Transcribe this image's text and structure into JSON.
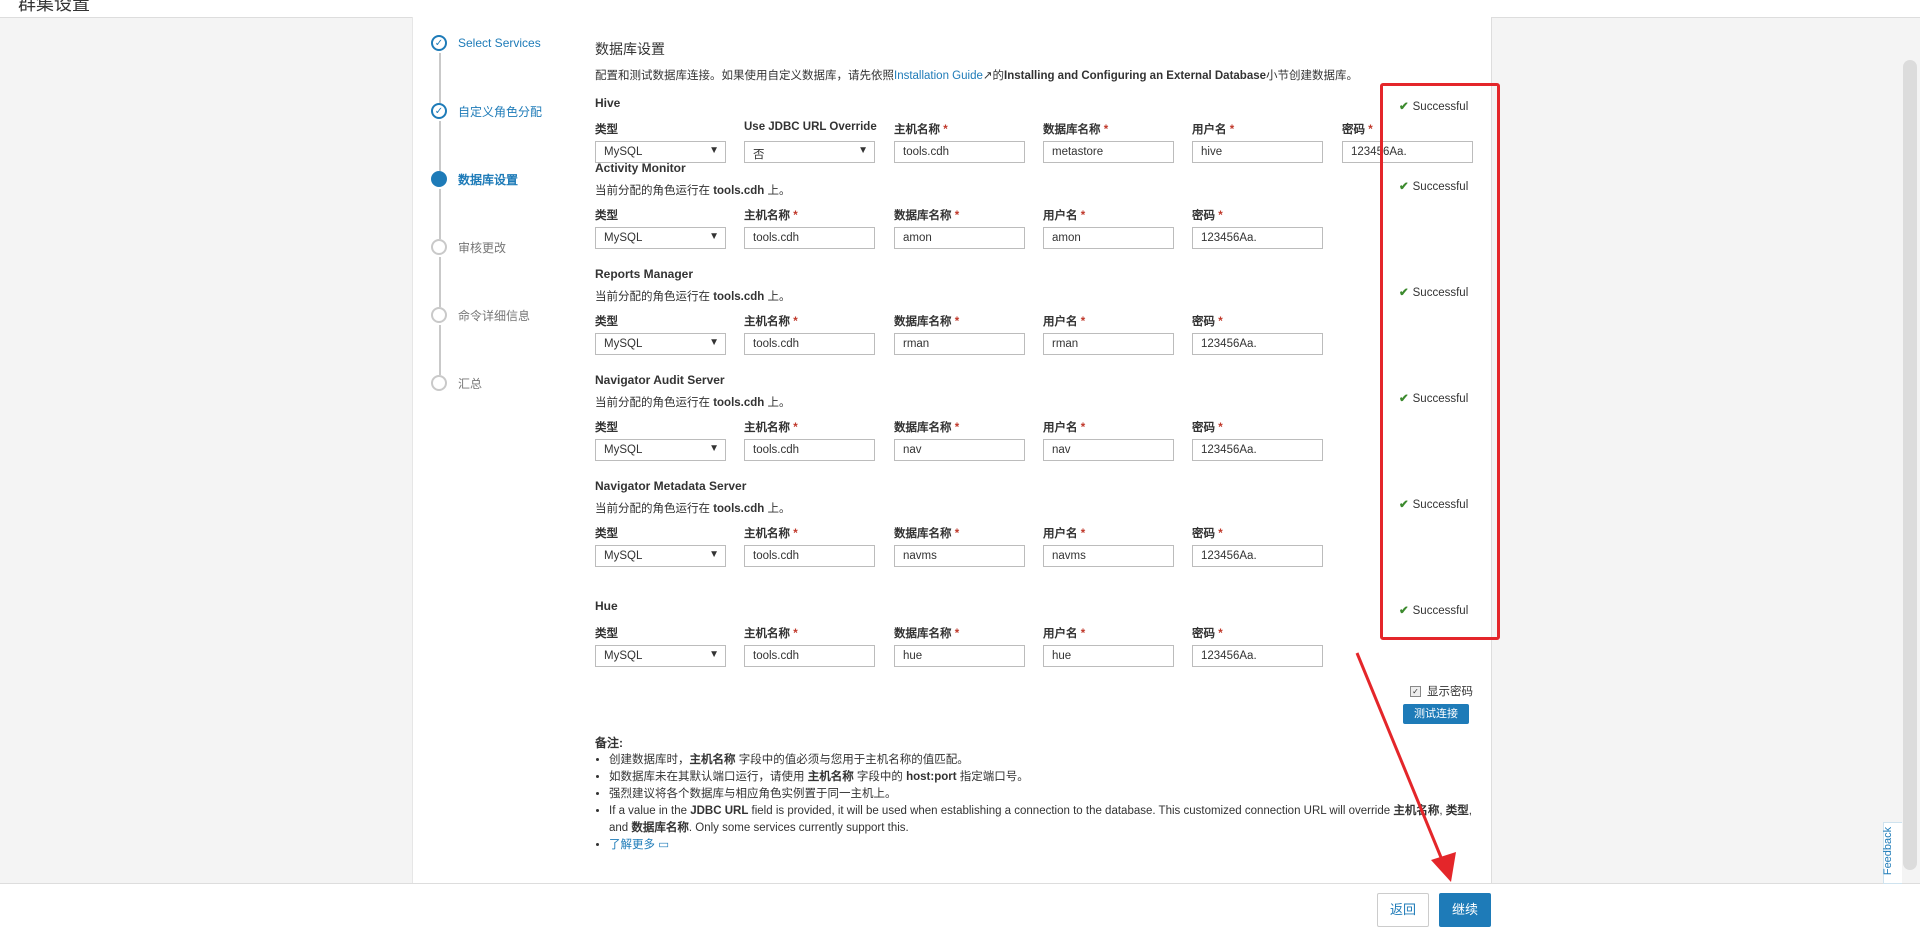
{
  "window_title": "群集设置",
  "steps": [
    {
      "label": "Select Services",
      "state": "done"
    },
    {
      "label": "自定义角色分配",
      "state": "done"
    },
    {
      "label": "数据库设置",
      "state": "active"
    },
    {
      "label": "审核更改",
      "state": "pending"
    },
    {
      "label": "命令详细信息",
      "state": "pending"
    },
    {
      "label": "汇总",
      "state": "pending"
    }
  ],
  "page": {
    "heading": "数据库设置",
    "intro_pre": "配置和测试数据库连接。如果使用自定义数据库，请先依照",
    "intro_link": "Installation Guide",
    "intro_mid": "的",
    "intro_bold": "Installing and Configuring an External Database",
    "intro_post": "小节创建数据库。"
  },
  "labels": {
    "type": "类型",
    "jdbc_override": "Use JDBC URL Override",
    "host": "主机名称",
    "dbname": "数据库名称",
    "user": "用户名",
    "password": "密码",
    "required": "*",
    "assign_pre": "当前分配的角色运行在",
    "assign_post": "上。"
  },
  "status_text": "Successful",
  "status_icon": "check-icon",
  "hive": {
    "title": "Hive",
    "type": "MySQL",
    "jdbc_override": "否",
    "host": "tools.cdh",
    "dbname": "metastore",
    "user": "hive",
    "password": "123456Aa."
  },
  "services": [
    {
      "title": "Activity Monitor",
      "host_assigned": "tools.cdh",
      "type": "MySQL",
      "host": "tools.cdh",
      "dbname": "amon",
      "user": "amon",
      "password": "123456Aa."
    },
    {
      "title": "Reports Manager",
      "host_assigned": "tools.cdh",
      "type": "MySQL",
      "host": "tools.cdh",
      "dbname": "rman",
      "user": "rman",
      "password": "123456Aa."
    },
    {
      "title": "Navigator Audit Server",
      "host_assigned": "tools.cdh",
      "type": "MySQL",
      "host": "tools.cdh",
      "dbname": "nav",
      "user": "nav",
      "password": "123456Aa."
    },
    {
      "title": "Navigator Metadata Server",
      "host_assigned": "tools.cdh",
      "type": "MySQL",
      "host": "tools.cdh",
      "dbname": "navms",
      "user": "navms",
      "password": "123456Aa."
    }
  ],
  "hue": {
    "title": "Hue",
    "type": "MySQL",
    "host": "tools.cdh",
    "dbname": "hue",
    "user": "hue",
    "password": "123456Aa."
  },
  "show_password_label": "显示密码",
  "test_button": "测试连接",
  "notes": {
    "title": "备注",
    "item1_pre": "创建数据库时，",
    "item1_bold": "主机名称",
    "item1_post": " 字段中的值必须与您用于主机名称的值匹配。",
    "item2_pre": "如数据库未在其默认端口运行，请使用 ",
    "item2_bold1": "主机名称",
    "item2_mid": " 字段中的 ",
    "item2_bold2": "host:port",
    "item2_post": " 指定端口号。",
    "item3": "强烈建议将各个数据库与相应角色实例置于同一主机上。",
    "item4_pre": "If a value in the ",
    "item4_bold1": "JDBC URL",
    "item4_mid1": " field is provided, it will be used when establishing a connection to the database. This customized connection URL will override ",
    "item4_bold2": "主机名称",
    "item4_mid2": ", ",
    "item4_bold3": "类型",
    "item4_mid3": ", and ",
    "item4_bold4": "数据库名称",
    "item4_post": ". Only some services currently support this.",
    "learn_more": "了解更多"
  },
  "buttons": {
    "back": "返回",
    "continue": "继续"
  },
  "feedback": "Feedback",
  "colors": {
    "accent": "#1e7bb8",
    "annotation": "#e4262a",
    "success": "#3c8a2e"
  }
}
